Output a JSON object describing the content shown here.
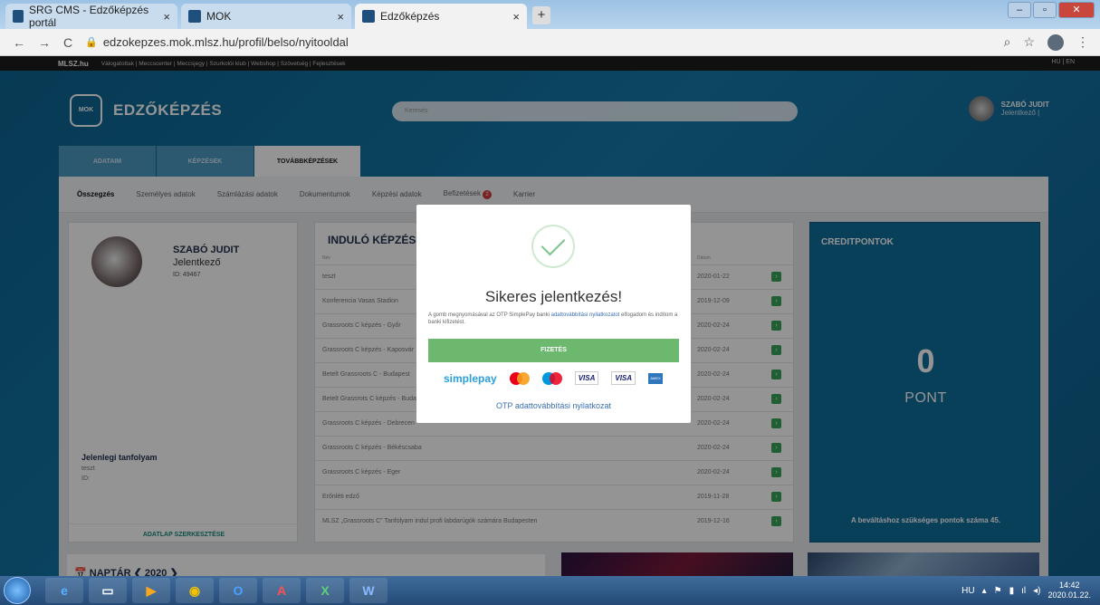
{
  "browser": {
    "tabs": [
      {
        "title": "SRG CMS - Edzőképzés portál",
        "close": "×"
      },
      {
        "title": "MOK",
        "close": "×"
      },
      {
        "title": "Edzőképzés",
        "close": "×"
      }
    ],
    "new_tab": "+",
    "url": "edzokepzes.mok.mlsz.hu/profil/belso/nyitooldal"
  },
  "site_nav": {
    "logo": "MLSZ.hu",
    "links": "Válogatottak | Meccscenter | Meccsjegy | Szurkolói klub | Webshop | Szövetség | Fejlesztések",
    "lang": "HU | EN"
  },
  "header": {
    "brand": "EDZŐKÉPZÉS",
    "logo_text": "MOK",
    "search_placeholder": "Keresés",
    "user_name": "SZABÓ JUDIT",
    "user_role": "Jelentkező |"
  },
  "profile_tabs": [
    "ADATAIM",
    "KÉPZÉSEK",
    "TOVÁBBKÉPZÉSEK"
  ],
  "subnav": {
    "items": [
      "Összegzés",
      "Személyes adatok",
      "Számlázási adatok",
      "Dokumentumok",
      "Képzési adatok",
      "Befizetések",
      "Karrier"
    ],
    "badge": "2"
  },
  "profile": {
    "name": "SZABÓ JUDIT",
    "role": "Jelentkező",
    "id": "ID: 49467",
    "current_course_title": "Jelenlegi tanfolyam",
    "current_course": "teszt",
    "current_id": "ID:",
    "edit_link": "ADATLAP SZERKESZTÉSE"
  },
  "courses": {
    "title": "INDULÓ KÉPZÉSEK",
    "col_name": "Név",
    "col_date": "Dátum",
    "rows": [
      {
        "name": "teszt",
        "date": "2020-01-22"
      },
      {
        "name": "Konferencia Vasas Stadion",
        "date": "2019-12-09"
      },
      {
        "name": "Grassroots C képzés - Győr",
        "date": "2020-02-24"
      },
      {
        "name": "Grassroots C képzés - Kaposvár",
        "date": "2020-02-24"
      },
      {
        "name": "Betelt Grassroots C - Budapest",
        "date": "2020-02-24"
      },
      {
        "name": "Betelt Grassrots C képzés - Budapest",
        "date": "2020-02-24"
      },
      {
        "name": "Grassroots C képzés - Debrecen",
        "date": "2020-02-24"
      },
      {
        "name": "Grassroots C képzés - Békéscsaba",
        "date": "2020-02-24"
      },
      {
        "name": "Grassroots C képzés - Eger",
        "date": "2020-02-24"
      },
      {
        "name": "Erőnléti edző",
        "date": "2019-11-28"
      },
      {
        "name": "MLSZ „Grassroots C\" Tanfolyam indul profi labdarúgók számára Budapesten",
        "date": "2019-12-16"
      }
    ],
    "go": "›"
  },
  "credits": {
    "title": "CREDITPONTOK",
    "value": "0",
    "unit": "PONT",
    "note": "A beváltáshoz szükséges pontok száma 45."
  },
  "calendar": {
    "label": "📅 NAPTÁR  ❮ 2020 ❯"
  },
  "modal": {
    "title": "Sikeres jelentkezés!",
    "text_before": "A gomb megnyomásával az OTP SimplePay banki ",
    "text_link": "adattovábbítási nyilatkozatot",
    "text_after": " elfogadom és indítom a banki kifizetést.",
    "pay_button": "FIZETÉS",
    "simplepay": "simplepay",
    "visa1": "VISA",
    "visa2": "VISA",
    "otp_link": "OTP adattovábbítási nyilatkozat"
  },
  "taskbar": {
    "lang": "HU",
    "time": "14:42",
    "date": "2020.01.22."
  }
}
